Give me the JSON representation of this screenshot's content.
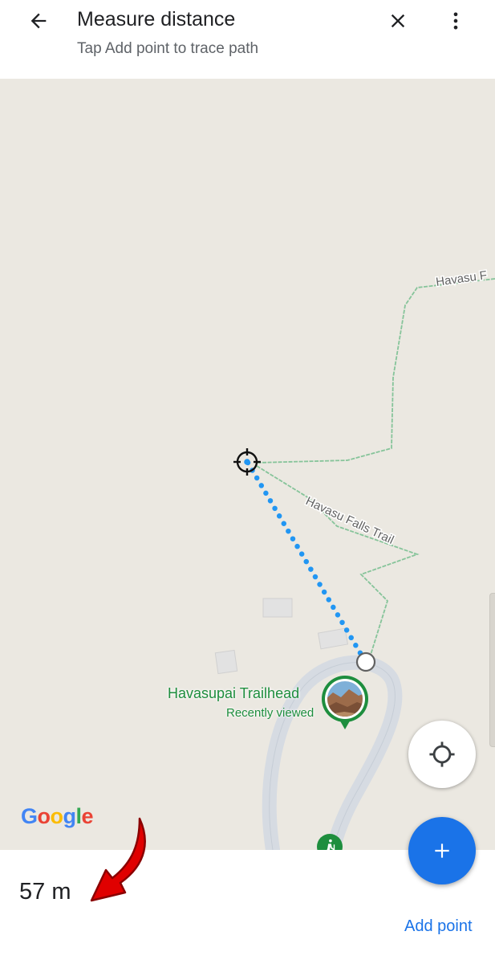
{
  "topbar": {
    "title": "Measure distance",
    "subtitle": "Tap Add point to trace path"
  },
  "icons": {
    "back": "arrow-back-icon",
    "close": "close-icon",
    "more": "more-vert-icon",
    "locate": "my-location-icon",
    "add": "plus-icon",
    "hike": "hiking-icon",
    "crosshair": "crosshair-icon"
  },
  "map": {
    "trail_label_1": "Havasu F",
    "trail_label_2": "Havasu Falls Trail",
    "place": {
      "name": "Havasupai Trailhead",
      "subtitle": "Recently viewed"
    },
    "logo": {
      "letters": [
        "G",
        "o",
        "o",
        "g",
        "l",
        "e"
      ],
      "colors": [
        "#4285F4",
        "#EA4335",
        "#FBBC05",
        "#4285F4",
        "#34A853",
        "#EA4335"
      ]
    }
  },
  "bottom": {
    "distance": "57 m",
    "add_point_label": "Add point"
  },
  "colors": {
    "accent": "#1a73e8",
    "trail_green": "#1e8e3e",
    "path_dots": "#2196f3",
    "annotation_arrow": "#e00000"
  }
}
